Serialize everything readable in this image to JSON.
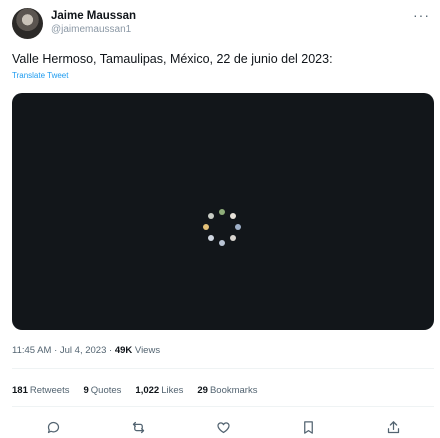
{
  "tweet": {
    "author": {
      "display_name": "Jaime Maussan",
      "handle": "@jaimemaussan1"
    },
    "more_label": "···",
    "text": "Valle Hermoso, Tamaulipas, México, 22 de junio del 2023:",
    "translate_label": "Translate Tweet",
    "meta": {
      "time": "11:45 AM",
      "separator": " · ",
      "date": "Jul 4, 2023",
      "views_separator": " · ",
      "views_count": "49K",
      "views_label": "Views"
    },
    "stats": [
      {
        "count": "181",
        "label": "Retweets"
      },
      {
        "count": "9",
        "label": "Quotes"
      },
      {
        "count": "1,022",
        "label": "Likes"
      },
      {
        "count": "29",
        "label": "Bookmarks"
      }
    ],
    "actions": [
      "reply-icon",
      "retweet-icon",
      "like-icon",
      "bookmark-icon",
      "share-icon"
    ],
    "colors": {
      "accent": "#1d9bf0",
      "media_bg": "#12161a",
      "secondary_text": "#536471"
    }
  }
}
